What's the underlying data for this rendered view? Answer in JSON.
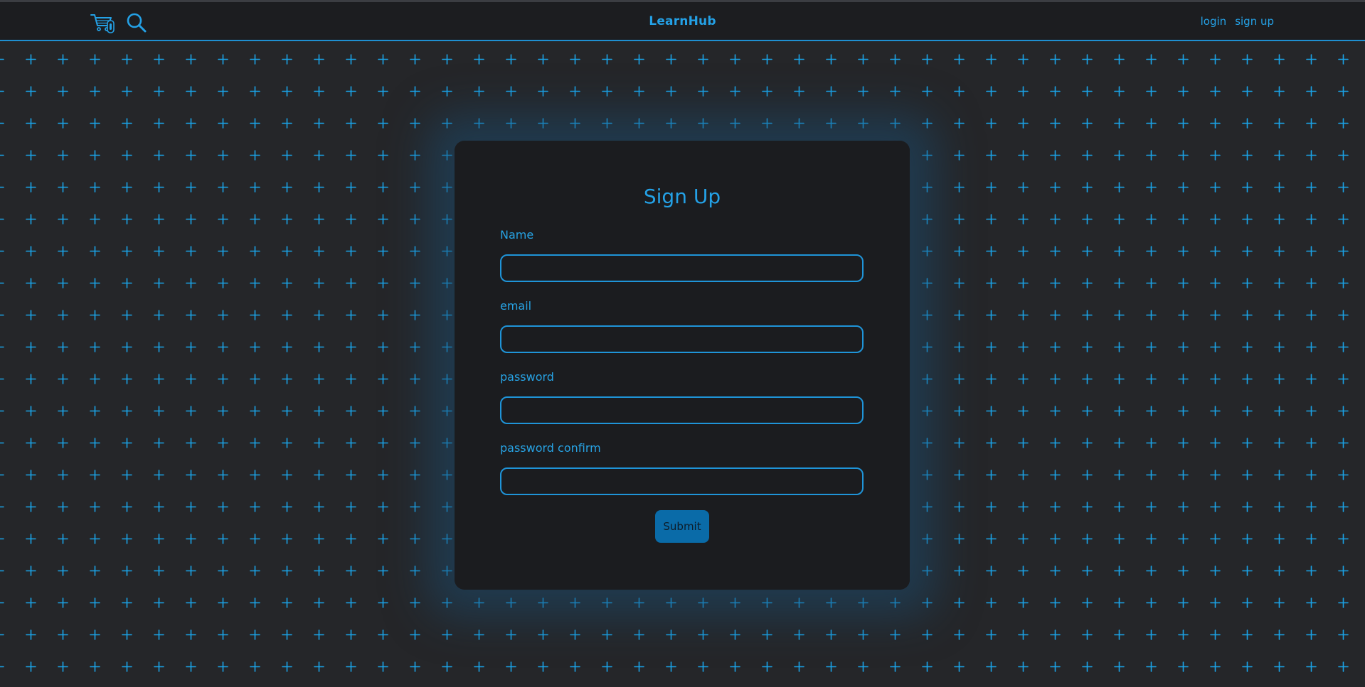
{
  "navbar": {
    "brand": "LearnHub",
    "icons": [
      "cart-icon",
      "search-icon"
    ],
    "links": {
      "login": "login",
      "signup": "sign up"
    }
  },
  "form": {
    "title": "Sign Up",
    "fields": [
      {
        "label": "Name",
        "value": "",
        "placeholder": ""
      },
      {
        "label": "email",
        "value": "",
        "placeholder": ""
      },
      {
        "label": "password",
        "value": "",
        "placeholder": ""
      },
      {
        "label": "password confirm",
        "value": "",
        "placeholder": ""
      }
    ],
    "submit_label": "Submit"
  },
  "colors": {
    "accent": "#24a1e6",
    "button": "#0a6ba8",
    "background": "#252629",
    "card": "#1b1c1f",
    "navbar": "#1c1d20"
  }
}
